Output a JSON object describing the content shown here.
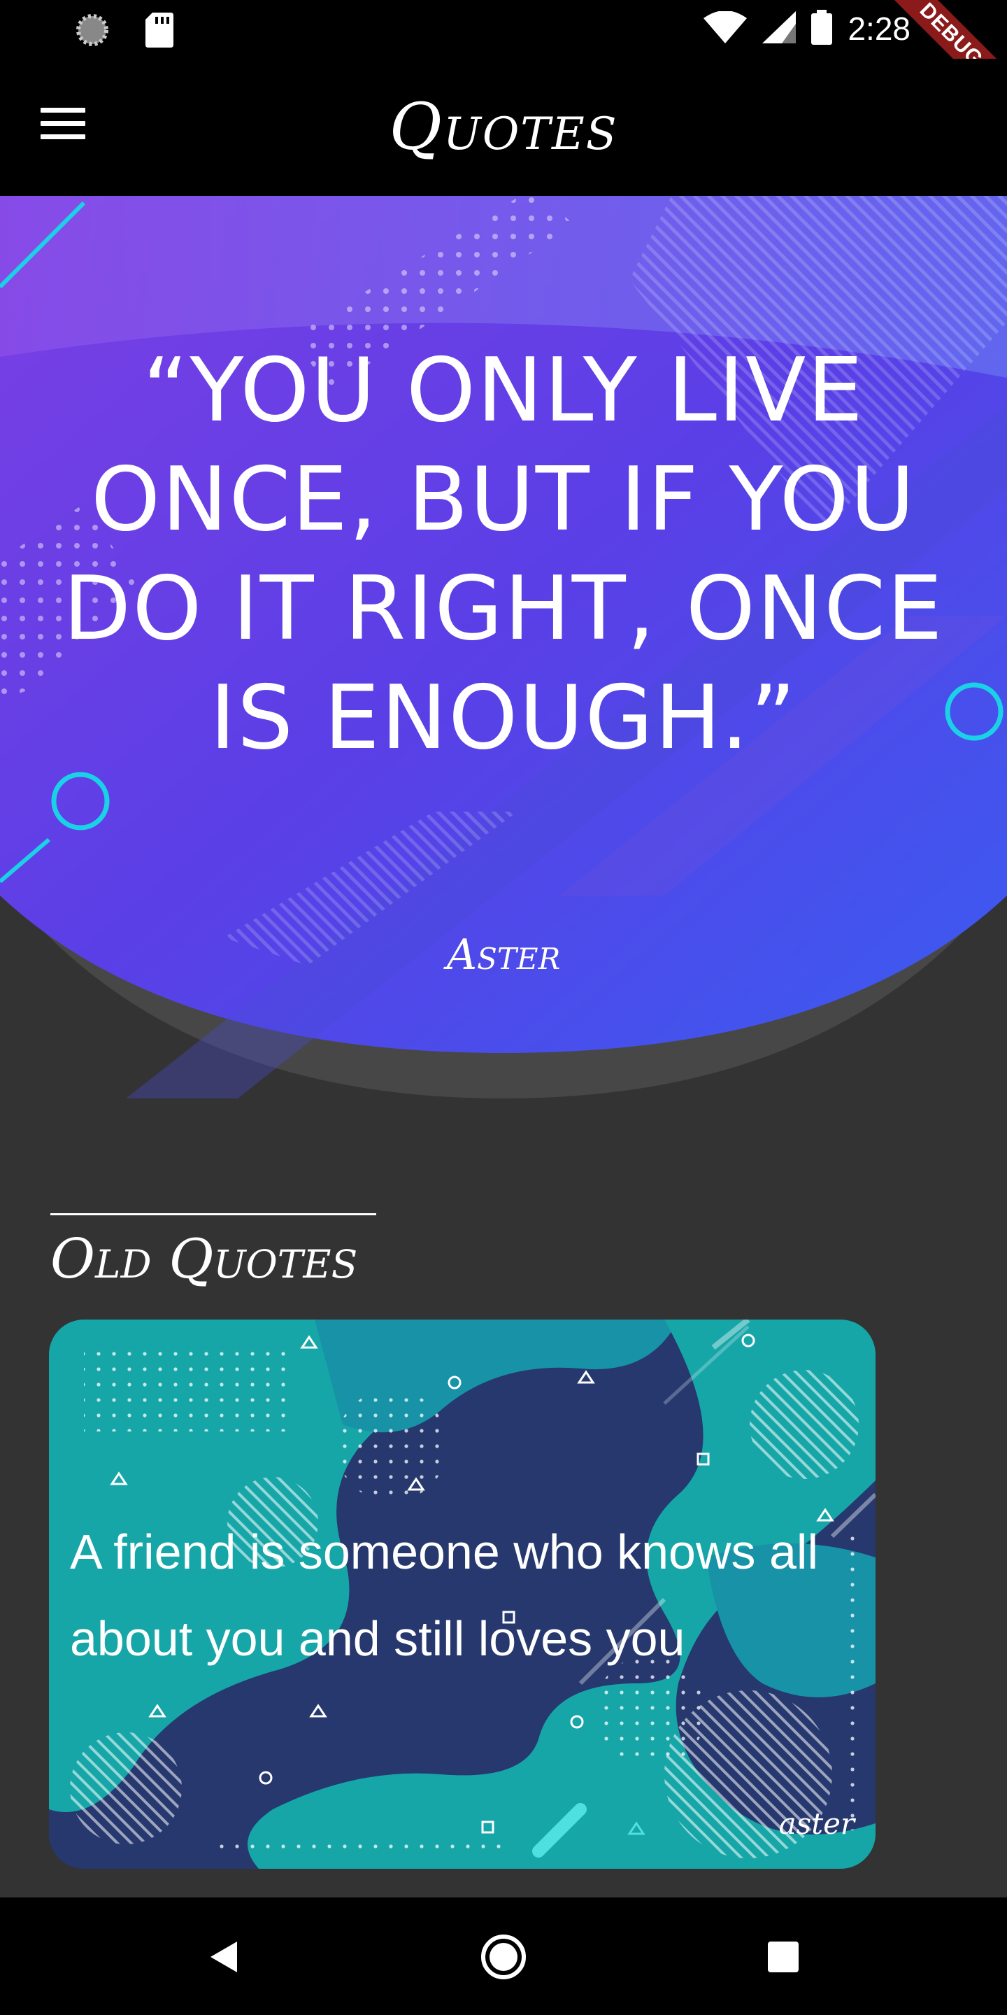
{
  "status_bar": {
    "time": "2:28",
    "debug_label": "DEBUG",
    "icons": [
      "loading-icon",
      "sd-card-icon",
      "wifi-icon",
      "signal-icon",
      "battery-icon"
    ]
  },
  "app_bar": {
    "title": "Quotes",
    "menu_icon": "hamburger-menu-icon"
  },
  "hero": {
    "quote": "“You only live once, but if you do it right, once is enough.”",
    "author": "Aster"
  },
  "old_quotes": {
    "title": "Old Quotes",
    "cards": [
      {
        "quote": "A friend is someone who knows all about you and still loves you",
        "author": "aster"
      }
    ]
  },
  "nav_bar": {
    "icons": [
      "back-icon",
      "home-icon",
      "recents-icon"
    ]
  },
  "colors": {
    "background": "#333333",
    "bars": "#000000",
    "hero_gradient_start": "#7b3fe4",
    "hero_gradient_end": "#3a5cf0",
    "accent_cyan": "#1ad1e6",
    "card_teal": "#16a6a8",
    "card_navy": "#26386e",
    "debug_ribbon": "#8b1a1a"
  }
}
